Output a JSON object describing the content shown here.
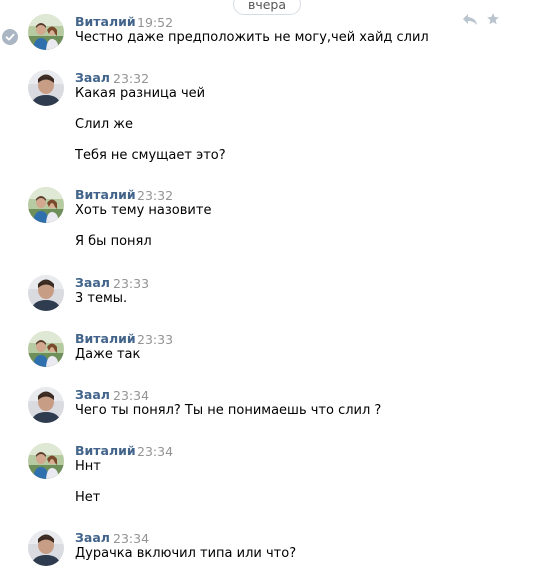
{
  "date_divider": "вчера",
  "messages": [
    {
      "author": "Виталий",
      "time": "19:52",
      "lines": [
        "Честно даже предположить не могу,чей хайд слил"
      ],
      "avatar": "avatar-vitaly",
      "read_check": true,
      "actions": [
        "reply-icon",
        "star-icon"
      ]
    },
    {
      "author": "Заал",
      "time": "23:32",
      "lines": [
        "Какая разница чей",
        "Слил же",
        "Тебя не смущает это?"
      ],
      "avatar": "avatar-zaal"
    },
    {
      "author": "Виталий",
      "time": "23:32",
      "lines": [
        "Хоть тему назовите",
        "Я бы понял"
      ],
      "avatar": "avatar-vitaly"
    },
    {
      "author": "Заал",
      "time": "23:33",
      "lines": [
        "3 темы."
      ],
      "avatar": "avatar-zaal"
    },
    {
      "author": "Виталий",
      "time": "23:33",
      "lines": [
        "Даже так"
      ],
      "avatar": "avatar-vitaly"
    },
    {
      "author": "Заал",
      "time": "23:34",
      "lines": [
        "Чего ты понял? Ты не понимаешь что слил ?"
      ],
      "avatar": "avatar-zaal"
    },
    {
      "author": "Виталий",
      "time": "23:34",
      "lines": [
        "Ннт",
        "Нет"
      ],
      "avatar": "avatar-vitaly"
    },
    {
      "author": "Заал",
      "time": "23:34",
      "lines": [
        "Дурачка включил типа или что?"
      ],
      "avatar": "avatar-zaal"
    }
  ],
  "colors": {
    "author": "#42648b",
    "time": "#939393",
    "text": "#000000",
    "icon": "#b9c4cf"
  }
}
